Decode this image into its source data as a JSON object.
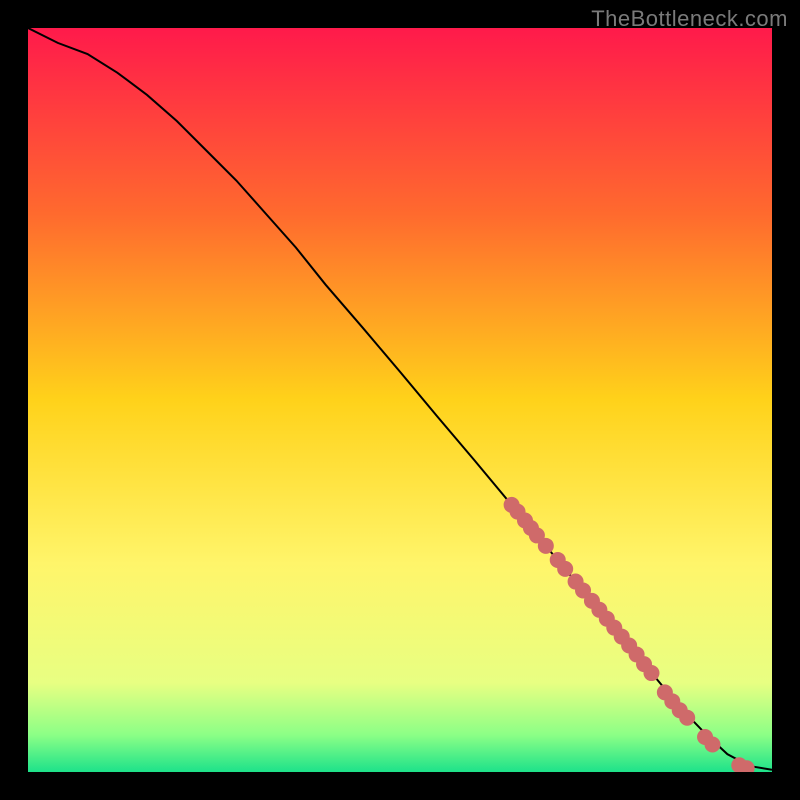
{
  "watermark": "TheBottleneck.com",
  "chart_data": {
    "type": "line",
    "title": "",
    "xlabel": "",
    "ylabel": "",
    "xlim": [
      0,
      100
    ],
    "ylim": [
      0,
      100
    ],
    "grid": false,
    "gradient_stops": [
      {
        "offset": 0,
        "color": "#ff1a4b"
      },
      {
        "offset": 25,
        "color": "#ff6a2e"
      },
      {
        "offset": 50,
        "color": "#ffd21a"
      },
      {
        "offset": 72,
        "color": "#fff56a"
      },
      {
        "offset": 88,
        "color": "#e8ff82"
      },
      {
        "offset": 95,
        "color": "#8cff86"
      },
      {
        "offset": 100,
        "color": "#1de28a"
      }
    ],
    "curve": {
      "name": "bottleneck-curve",
      "color": "#000000",
      "width": 2,
      "x": [
        0,
        4,
        8,
        12,
        16,
        20,
        24,
        28,
        32,
        36,
        40,
        45,
        50,
        55,
        60,
        65,
        70,
        75,
        78,
        82,
        85,
        88,
        91,
        94,
        97,
        100
      ],
      "y": [
        100,
        98,
        96.5,
        94,
        91,
        87.5,
        83.5,
        79.5,
        75,
        70.5,
        65.5,
        59.7,
        53.8,
        47.8,
        41.9,
        35.9,
        29.9,
        23.9,
        20.3,
        15.5,
        11.9,
        8.3,
        5.2,
        2.4,
        0.8,
        0.3
      ]
    },
    "scatter": {
      "name": "highlighted-points",
      "color": "#cf6a6a",
      "radius": 8,
      "x": [
        65.0,
        65.8,
        66.8,
        67.6,
        68.4,
        69.6,
        71.2,
        72.2,
        73.6,
        74.6,
        75.8,
        76.8,
        77.8,
        78.8,
        79.8,
        80.8,
        81.8,
        82.8,
        83.8,
        85.6,
        86.6,
        87.6,
        88.6,
        91.0,
        92.0,
        95.6,
        96.6
      ],
      "y": [
        35.9,
        35.0,
        33.8,
        32.8,
        31.8,
        30.4,
        28.5,
        27.3,
        25.6,
        24.4,
        23.0,
        21.8,
        20.6,
        19.4,
        18.2,
        17.0,
        15.8,
        14.5,
        13.3,
        10.7,
        9.5,
        8.3,
        7.3,
        4.7,
        3.7,
        0.9,
        0.5
      ]
    }
  }
}
